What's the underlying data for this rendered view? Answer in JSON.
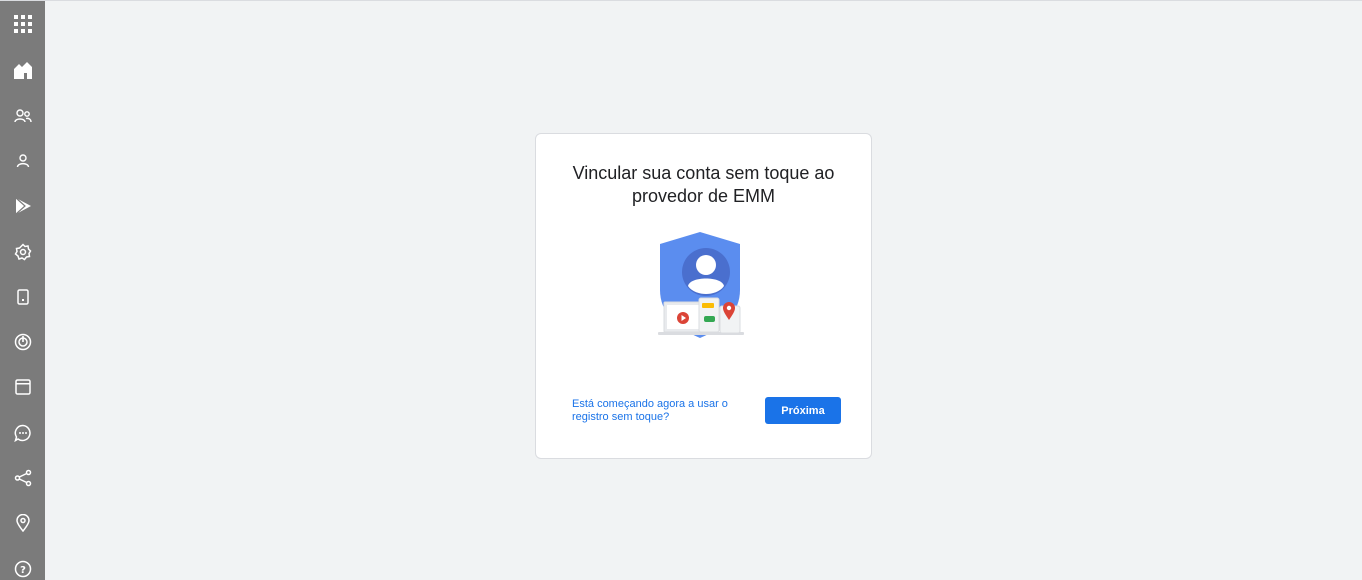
{
  "sidebar": {
    "items": [
      {
        "icon": "apps-grid-icon"
      },
      {
        "icon": "home-icon"
      },
      {
        "icon": "users-icon"
      },
      {
        "icon": "user-icon"
      },
      {
        "icon": "play-store-icon"
      },
      {
        "icon": "settings-icon"
      },
      {
        "icon": "device-icon"
      },
      {
        "icon": "security-icon"
      },
      {
        "icon": "browser-icon"
      },
      {
        "icon": "chat-icon"
      },
      {
        "icon": "share-icon"
      },
      {
        "icon": "location-icon"
      },
      {
        "icon": "help-icon"
      }
    ]
  },
  "card": {
    "title": "Vincular sua conta sem toque ao provedor de EMM",
    "help_link": "Está começando agora a usar o registro sem toque?",
    "next_button": "Próxima"
  },
  "colors": {
    "rail": "#7b7b7b",
    "background": "#f1f3f4",
    "accent": "#1a73e8",
    "shield": "#5b8def",
    "shield_dark": "#4a6fce"
  }
}
